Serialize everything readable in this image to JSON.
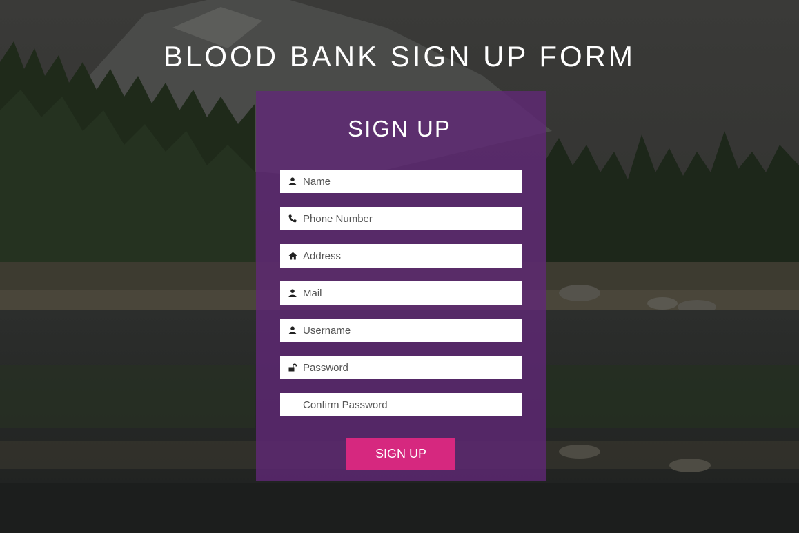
{
  "page_title": "BLOOD BANK SIGN UP FORM",
  "form": {
    "heading": "SIGN UP",
    "fields": [
      {
        "placeholder": "Name",
        "icon": "user-icon",
        "type": "text"
      },
      {
        "placeholder": "Phone Number",
        "icon": "phone-icon",
        "type": "text"
      },
      {
        "placeholder": "Address",
        "icon": "home-icon",
        "type": "text"
      },
      {
        "placeholder": "Mail",
        "icon": "user-icon",
        "type": "text"
      },
      {
        "placeholder": "Username",
        "icon": "user-icon",
        "type": "text"
      },
      {
        "placeholder": "Password",
        "icon": "unlock-icon",
        "type": "password"
      },
      {
        "placeholder": "Confirm Password",
        "icon": "",
        "type": "password"
      }
    ],
    "submit_label": "SIGN UP"
  },
  "colors": {
    "panel": "#62287899",
    "button": "#d6287f",
    "text": "#ffffff"
  }
}
